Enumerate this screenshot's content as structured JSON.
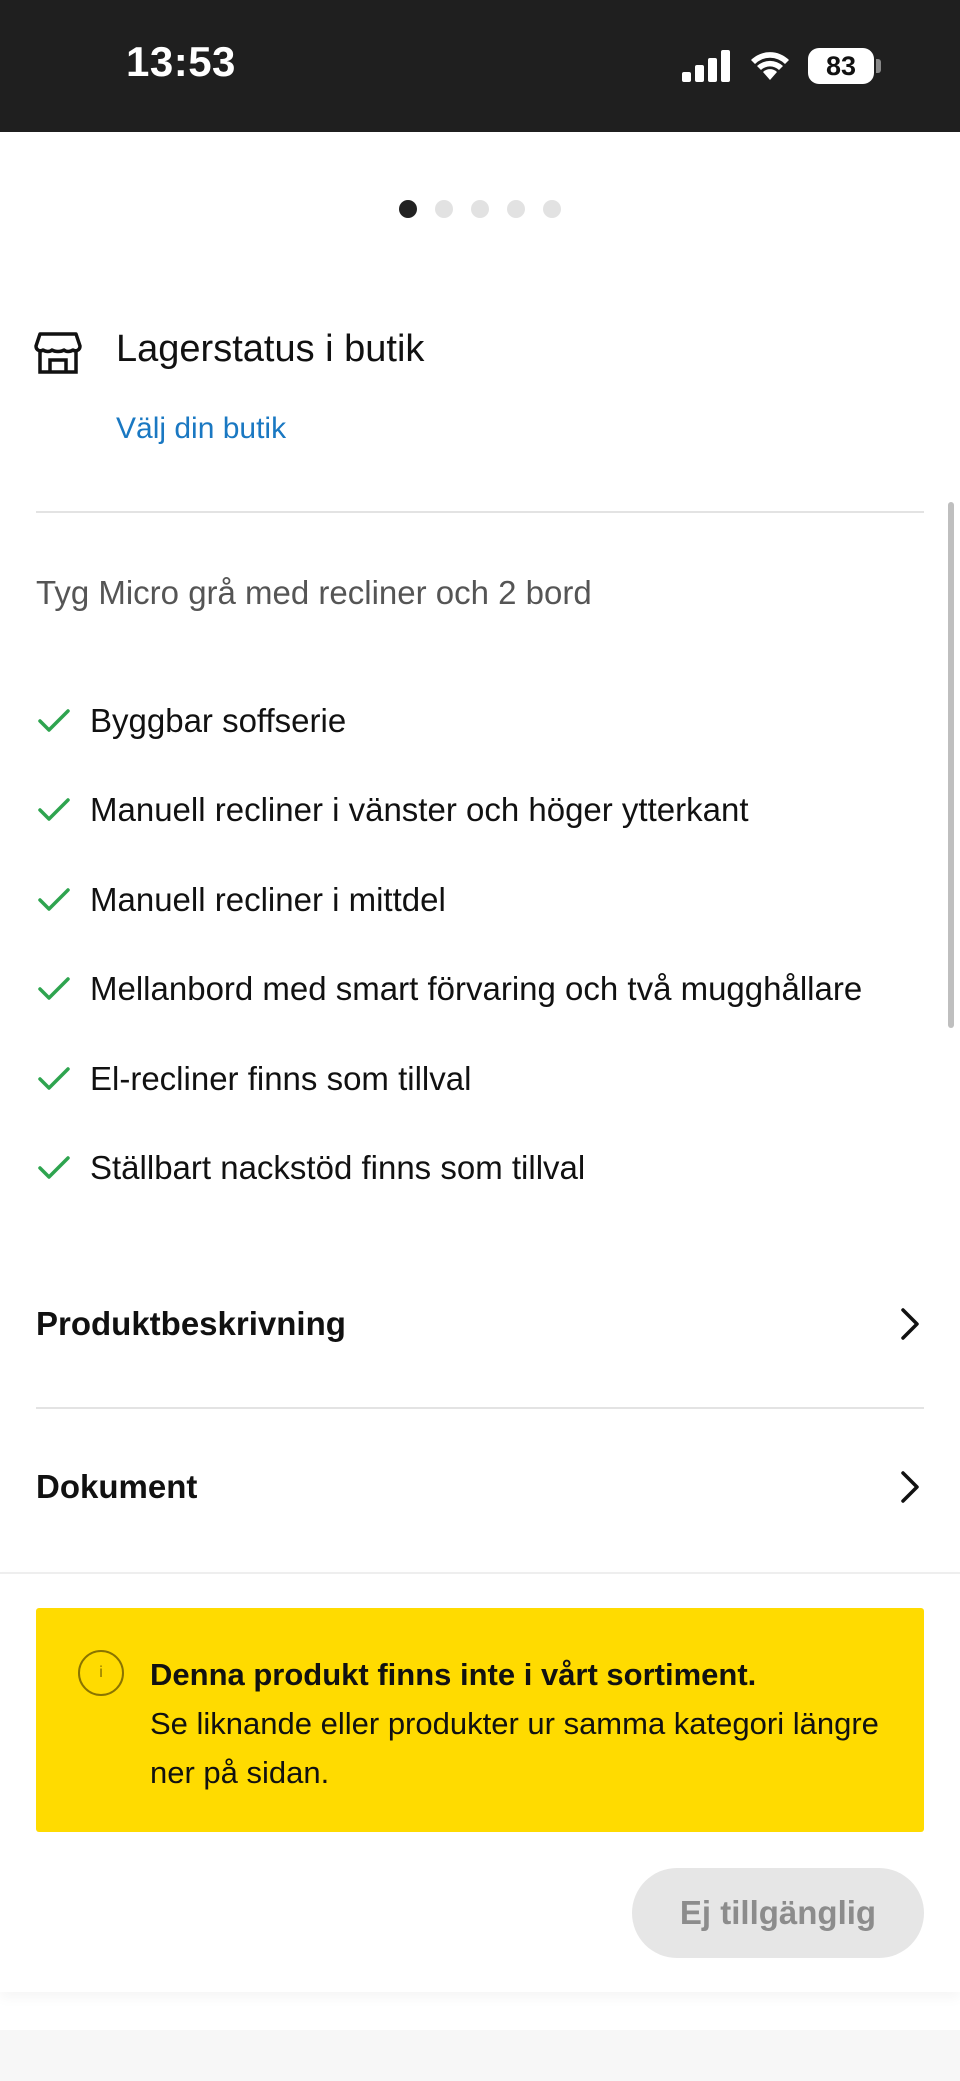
{
  "status_bar": {
    "time": "13:53",
    "battery": "83"
  },
  "carousel": {
    "total": 5,
    "active_index": 0
  },
  "store_status": {
    "title": "Lagerstatus i butik",
    "link": "Välj din butik"
  },
  "product": {
    "variant": "Tyg Micro grå med recliner och 2 bord",
    "features": [
      "Byggbar soffserie",
      "Manuell recliner i vänster och höger ytterkant",
      "Manuell recliner i mittdel",
      "Mellanbord med smart förvaring och två mugghållare",
      "El-recliner finns som tillval",
      "Ställbart nackstöd finns som tillval"
    ]
  },
  "accordion": {
    "description": "Produktbeskrivning",
    "documents": "Dokument"
  },
  "notice": {
    "title": "Denna produkt finns inte i vårt sortiment.",
    "text": "Se liknande eller produkter ur samma kategori längre ner på sidan."
  },
  "buy_button": {
    "label": "Ej tillgänglig"
  },
  "colors": {
    "accent_blue": "#1a78c2",
    "check_green": "#2ea44f",
    "notice_yellow": "#ffdb00"
  }
}
